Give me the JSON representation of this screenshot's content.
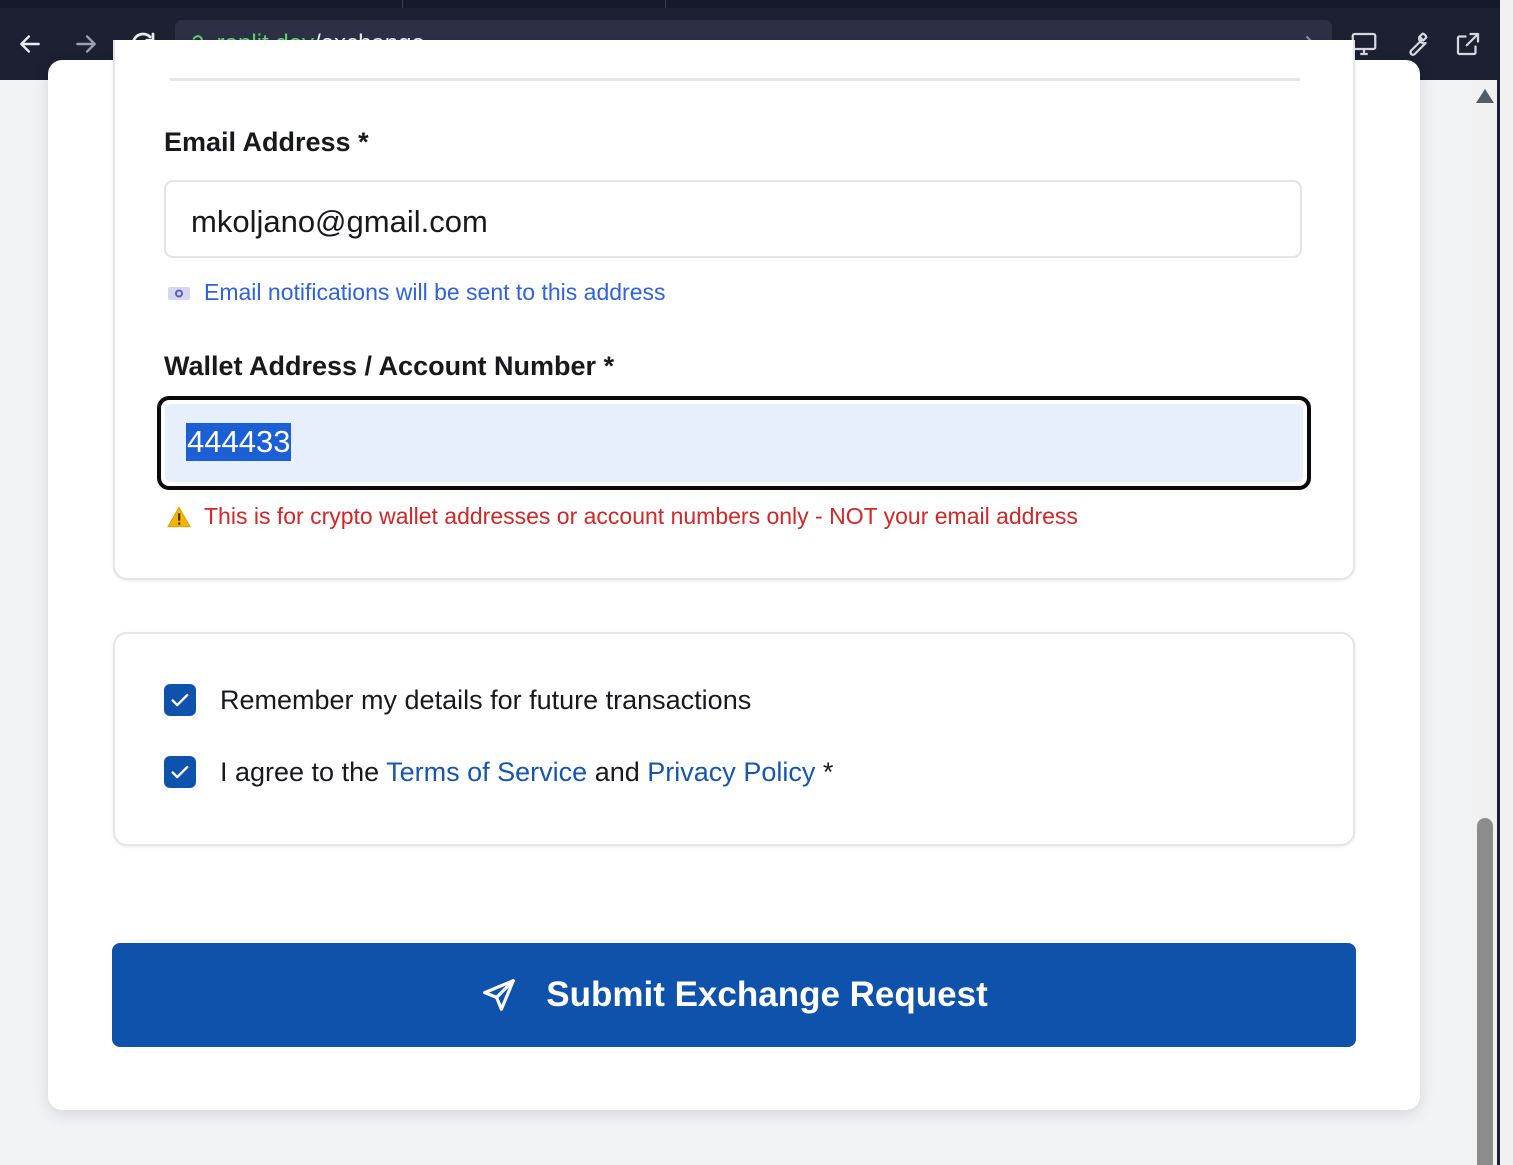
{
  "browser": {
    "url_host": ".replit.dev",
    "url_path": "/exchange"
  },
  "form": {
    "email": {
      "label": "Email Address *",
      "value": "mkoljano@gmail.com",
      "hint": "Email notifications will be sent to this address",
      "hint_icon": "email-icon"
    },
    "wallet": {
      "label": "Wallet Address / Account Number *",
      "value": "444433",
      "warning": "This is for crypto wallet addresses or account numbers only - NOT your email address",
      "warning_icon": "warning-icon"
    }
  },
  "options": {
    "remember": {
      "label": "Remember my details for future transactions",
      "checked": true
    },
    "agree": {
      "prefix": "I agree to the",
      "terms_link": "Terms of Service",
      "and": "and",
      "privacy_link": "Privacy Policy",
      "suffix": "*",
      "checked": true
    }
  },
  "submit": {
    "label": "Submit Exchange Request",
    "icon": "send-icon"
  },
  "colors": {
    "primary": "#0f52ac",
    "info": "#2e62e0",
    "warning": "#d52525",
    "url_host": "#5ed06b"
  }
}
